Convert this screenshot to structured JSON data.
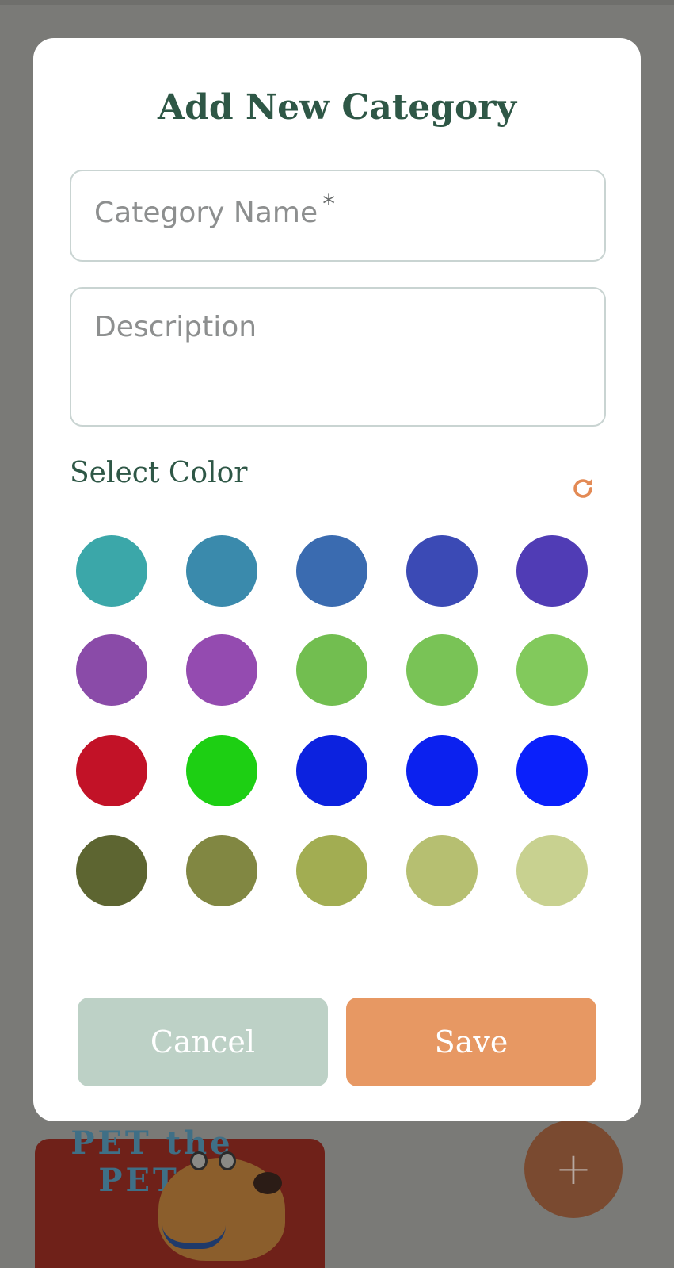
{
  "modal": {
    "title": "Add New Category",
    "name_placeholder": "Category Name",
    "name_required_marker": "*",
    "description_placeholder": "Description",
    "select_color_label": "Select Color",
    "refresh_icon": "refresh-icon",
    "cancel_label": "Cancel",
    "save_label": "Save"
  },
  "colors": [
    "#3ba7a9",
    "#3a8aac",
    "#3a6bb0",
    "#3b4ab5",
    "#503cb5",
    "#8a4ba8",
    "#944bb0",
    "#72be50",
    "#79c356",
    "#82c95c",
    "#c21227",
    "#1dcf13",
    "#0c22df",
    "#0b21ef",
    "#0a20fb",
    "#5d6531",
    "#818742",
    "#a2ad52",
    "#b6bf71",
    "#c8d190"
  ],
  "background": {
    "card_title": "PET the PETS",
    "fab_icon": "plus-icon",
    "fab_label": "+"
  },
  "theme": {
    "primary_text": "#2e5746",
    "accent": "#e79863",
    "cancel_bg": "#bdd1c6"
  }
}
